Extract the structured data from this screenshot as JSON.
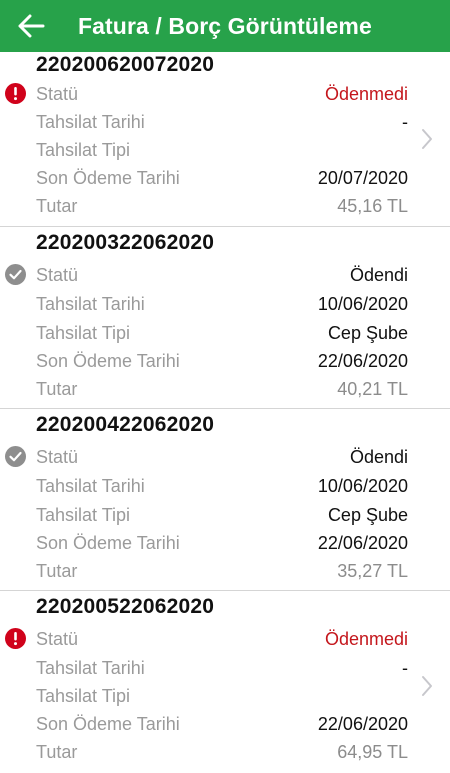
{
  "header": {
    "title": "Fatura / Borç Görüntüleme",
    "back_icon": "back-arrow-icon",
    "background": "#27a24a"
  },
  "labels": {
    "status": "Statü",
    "collection_date": "Tahsilat Tarihi",
    "collection_type": "Tahsilat Tipi",
    "due_date": "Son Ödeme Tarihi",
    "amount": "Tutar"
  },
  "invoices": [
    {
      "number": "220200620072020",
      "status": "Ödenmedi",
      "status_icon": "error-icon",
      "collection_date": "-",
      "collection_type": "",
      "due_date": "20/07/2020",
      "amount": "45,16 TL",
      "has_chevron": true
    },
    {
      "number": "220200322062020",
      "status": "Ödendi",
      "status_icon": "check-circle-icon",
      "collection_date": "10/06/2020",
      "collection_type": "Cep Şube",
      "due_date": "22/06/2020",
      "amount": "40,21 TL",
      "has_chevron": false
    },
    {
      "number": "220200422062020",
      "status": "Ödendi",
      "status_icon": "check-circle-icon",
      "collection_date": "10/06/2020",
      "collection_type": "Cep Şube",
      "due_date": "22/06/2020",
      "amount": "35,27 TL",
      "has_chevron": false
    },
    {
      "number": "220200522062020",
      "status": "Ödenmedi",
      "status_icon": "error-icon",
      "collection_date": "-",
      "collection_type": "",
      "due_date": "22/06/2020",
      "amount": "64,95 TL",
      "has_chevron": true
    }
  ],
  "colors": {
    "unpaid": "#c4161c",
    "paid_icon": "#8e8e8e",
    "error_icon": "#d0021b"
  }
}
